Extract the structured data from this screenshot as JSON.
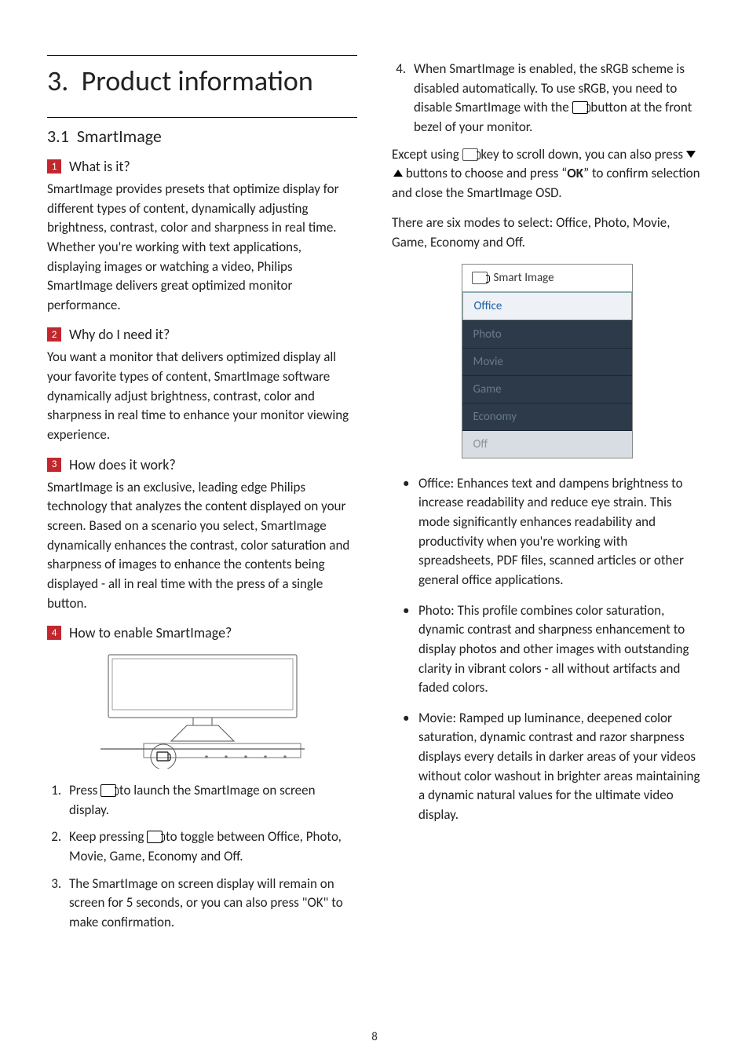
{
  "page_number": "8",
  "chapter": {
    "number": "3.",
    "title": "Product information"
  },
  "section": {
    "number": "3.1",
    "title": "SmartImage"
  },
  "blocks": {
    "b1": {
      "num": "1",
      "title": "What is it?",
      "text": "SmartImage provides presets that optimize display for different types of content, dynamically adjusting brightness, contrast, color and sharpness in real time. Whether you're working with text applications, displaying images or watching a video, Philips SmartImage delivers great optimized monitor performance."
    },
    "b2": {
      "num": "2",
      "title": "Why do I need it?",
      "text": "You want a monitor that delivers optimized display all your favorite types of content, SmartImage software dynamically adjust brightness, contrast, color and sharpness in real time to enhance your monitor viewing experience."
    },
    "b3": {
      "num": "3",
      "title": "How does it work?",
      "text": "SmartImage is an exclusive, leading edge Philips technology that analyzes the content displayed on your screen. Based on a scenario you select, SmartImage dynamically enhances the contrast, color saturation and sharpness of images to enhance the contents being displayed - all in real time with the press of a single button."
    },
    "b4": {
      "num": "4",
      "title": "How to enable SmartImage?"
    }
  },
  "steps": {
    "s1a": "Press ",
    "s1b": " to launch the SmartImage on screen display.",
    "s2a": "Keep pressing ",
    "s2b": " to toggle between Office, Photo, Movie, Game, Economy and Off.",
    "s3": "The SmartImage on screen display will remain on screen for 5 seconds, or you can also press \"OK\" to make confirmation.",
    "s4a": "When SmartImage is enabled, the sRGB scheme is disabled automatically. To use sRGB, you need to disable SmartImage with the ",
    "s4b": " button at the front bezel of your monitor."
  },
  "para_after": {
    "a": "Except using ",
    "b": " key to scroll down, you can also press ",
    "c": " buttons to choose and press “",
    "ok": "OK",
    "d": "” to confirm selection and close the SmartImage OSD."
  },
  "modes_intro": "There are six modes to select: Office, Photo, Movie, Game, Economy and Off.",
  "osd": {
    "title": "Smart Image",
    "items": [
      "Office",
      "Photo",
      "Movie",
      "Game",
      "Economy",
      "Off"
    ],
    "selected_index": 0
  },
  "mode_desc": {
    "office": {
      "label": "Office:",
      "text": " Enhances text and dampens brightness to increase readability and reduce eye strain. This mode significantly enhances readability and productivity when you're working with spreadsheets, PDF files, scanned articles or other general office applications."
    },
    "photo": {
      "label": "Photo:",
      "text": " This profile combines color saturation, dynamic contrast and sharpness enhancement to display photos and other images with outstanding clarity in vibrant colors - all without artifacts and faded colors."
    },
    "movie": {
      "label": "Movie:",
      "text": " Ramped up luminance, deepened color saturation, dynamic contrast and razor sharpness displays every details in darker areas of your videos without color washout in brighter areas maintaining a dynamic natural values for the ultimate video display."
    }
  }
}
